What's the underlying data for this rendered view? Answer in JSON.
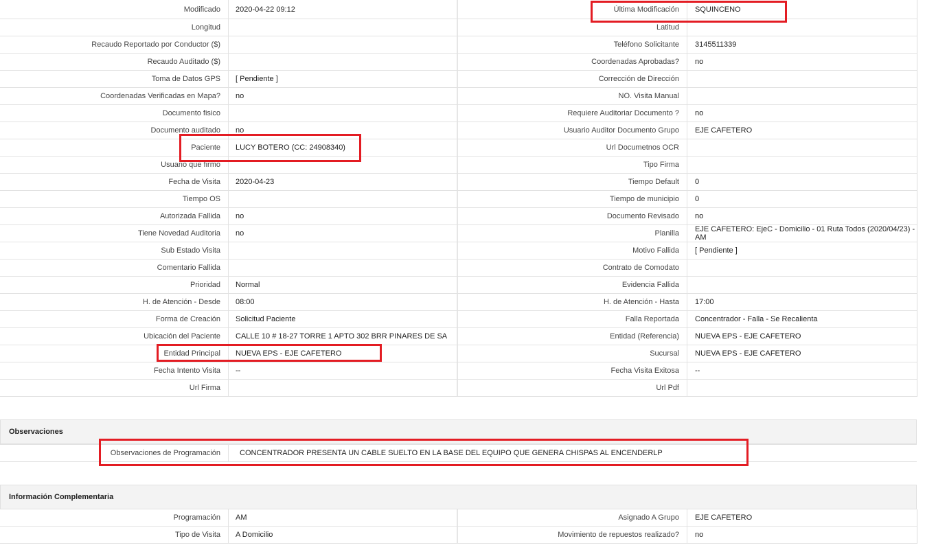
{
  "main_rows": [
    {
      "l1": "Modificado",
      "v1": "2020-04-22 09:12",
      "l2": "Última Modificación",
      "v2": "SQUINCENO"
    },
    {
      "l1": "Longitud",
      "v1": "",
      "l2": "Latitud",
      "v2": ""
    },
    {
      "l1": "Recaudo Reportado por Conductor ($)",
      "v1": "",
      "l2": "Teléfono Solicitante",
      "v2": "3145511339"
    },
    {
      "l1": "Recaudo Auditado ($)",
      "v1": "",
      "l2": "Coordenadas Aprobadas?",
      "v2": "no"
    },
    {
      "l1": "Toma de Datos GPS",
      "v1": "[ Pendiente ]",
      "l2": "Corrección de Dirección",
      "v2": ""
    },
    {
      "l1": "Coordenadas Verificadas en Mapa?",
      "v1": "no",
      "l2": "NO. Visita Manual",
      "v2": ""
    },
    {
      "l1": "Documento fisico",
      "v1": "",
      "l2": "Requiere Auditoriar Documento ?",
      "v2": "no"
    },
    {
      "l1": "Documento auditado",
      "v1": "no",
      "l2": "Usuario Auditor Documento Grupo",
      "v2": "EJE CAFETERO"
    },
    {
      "l1": "Paciente",
      "v1": "LUCY BOTERO (CC: 24908340)",
      "l2": "Url Documetnos OCR",
      "v2": ""
    },
    {
      "l1": "Usuario que firmo",
      "v1": "",
      "l2": "Tipo Firma",
      "v2": ""
    },
    {
      "l1": "Fecha de Visita",
      "v1": "2020-04-23",
      "l2": "Tiempo Default",
      "v2": "0"
    },
    {
      "l1": "Tiempo OS",
      "v1": "",
      "l2": "Tiempo de municipio",
      "v2": "0"
    },
    {
      "l1": "Autorizada Fallida",
      "v1": "no",
      "l2": "Documento Revisado",
      "v2": "no"
    },
    {
      "l1": "Tiene Novedad Auditoria",
      "v1": "no",
      "l2": "Planilla",
      "v2": "EJE CAFETERO: EjeC - Domicilio - 01 Ruta Todos (2020/04/23) - AM"
    },
    {
      "l1": "Sub Estado Visita",
      "v1": "",
      "l2": "Motivo Fallida",
      "v2": "[ Pendiente ]"
    },
    {
      "l1": "Comentario Fallida",
      "v1": "",
      "l2": "Contrato de Comodato",
      "v2": ""
    },
    {
      "l1": "Prioridad",
      "v1": "Normal",
      "l2": "Evidencia Fallida",
      "v2": ""
    },
    {
      "l1": "H. de Atención - Desde",
      "v1": "08:00",
      "l2": "H. de Atención - Hasta",
      "v2": "17:00"
    },
    {
      "l1": "Forma de Creación",
      "v1": "Solicitud Paciente",
      "l2": "Falla Reportada",
      "v2": "Concentrador - Falla - Se Recalienta"
    },
    {
      "l1": "Ubicación del Paciente",
      "v1": "CALLE 10 # 18-27 TORRE 1 APTO 302 BRR PINARES DE SA",
      "l2": "Entidad (Referencia)",
      "v2": "NUEVA EPS - EJE CAFETERO"
    },
    {
      "l1": "Entidad Principal",
      "v1": "NUEVA EPS - EJE CAFETERO",
      "l2": "Sucursal",
      "v2": "NUEVA EPS - EJE CAFETERO"
    },
    {
      "l1": "Fecha Intento Visita",
      "v1": "--",
      "l2": "Fecha Visita Exitosa",
      "v2": "--"
    },
    {
      "l1": "Url Firma",
      "v1": "",
      "l2": "Url Pdf",
      "v2": ""
    }
  ],
  "observaciones": {
    "title": "Observaciones",
    "label": "Observaciones de Programación",
    "value": "CONCENTRADOR PRESENTA UN CABLE SUELTO EN LA BASE DEL EQUIPO QUE GENERA CHISPAS AL ENCENDERLP"
  },
  "complementaria": {
    "title": "Información Complementaria",
    "rows": [
      {
        "l1": "Programación",
        "v1": "AM",
        "l2": "Asignado A Grupo",
        "v2": "EJE CAFETERO"
      },
      {
        "l1": "Tipo de Visita",
        "v1": "A Domicilio",
        "l2": "Movimiento de repuestos realizado?",
        "v2": "no"
      }
    ]
  },
  "highlight_color": "#e31c23"
}
